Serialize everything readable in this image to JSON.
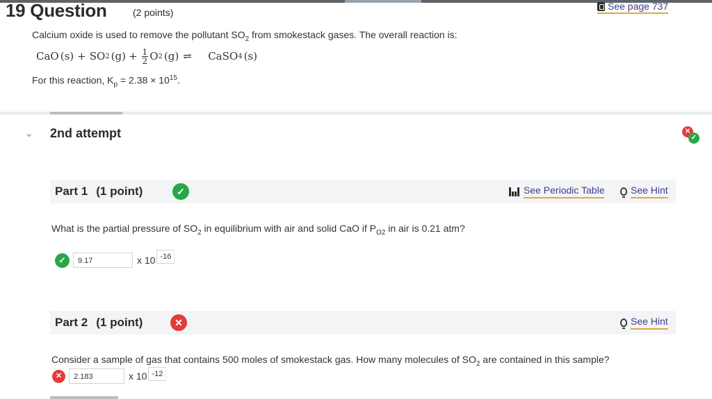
{
  "question": {
    "number": "19",
    "title_word": "Question",
    "points": "(2 points)",
    "see_page": "See page 737",
    "stem_pre": "Calcium oxide is used to remove the pollutant SO",
    "stem_sub": "2",
    "stem_post": " from smokestack gases. The overall reaction is:",
    "equation": {
      "t1": "CaO",
      "s1": "(s)",
      "plus1": "+",
      "t2": "SO",
      "t2sub": "2",
      "s2": "(g)",
      "plus2": "+",
      "frac_num": "1",
      "frac_den": "2",
      "t3": "O",
      "t3sub": "2",
      "s3": "(g)",
      "arrow": "⇌",
      "t4": "CaSO",
      "t4sub": "4",
      "s4": "(s)"
    },
    "kp_pre": "For this reaction, K",
    "kp_sub": "p",
    "kp_mid": " = 2.38 × 10",
    "kp_exp": "15",
    "kp_end": "."
  },
  "attempt": {
    "label": "2nd attempt"
  },
  "part1": {
    "title": "Part 1",
    "points": "(1 point)",
    "periodic_table": "See Periodic Table",
    "hint": "See Hint",
    "q_pre": "What is the partial pressure of SO",
    "q_sub": "2",
    "q_mid": " in equilibrium with air and solid CaO if P",
    "q_sub2": "O2",
    "q_post": " in air is 0.21 atm?",
    "answer": "9.17",
    "times": "x 10",
    "exponent": "-16"
  },
  "part2": {
    "title": "Part 2",
    "points": "(1 point)",
    "hint": "See Hint",
    "q_pre": "Consider a sample of gas that contains 500  moles of smokestack gas. How many molecules of SO",
    "q_sub": "2",
    "q_post": " are contained in this sample?",
    "answer": "2.183",
    "times": "x 10",
    "exponent": "-12"
  },
  "icons": {
    "check": "✓",
    "cross": "✕",
    "chevron": "⌄"
  },
  "colors": {
    "success": "#2aa64a",
    "error": "#e13b3b",
    "link": "#3d3d8f",
    "link_underline": "#e2a83c"
  }
}
